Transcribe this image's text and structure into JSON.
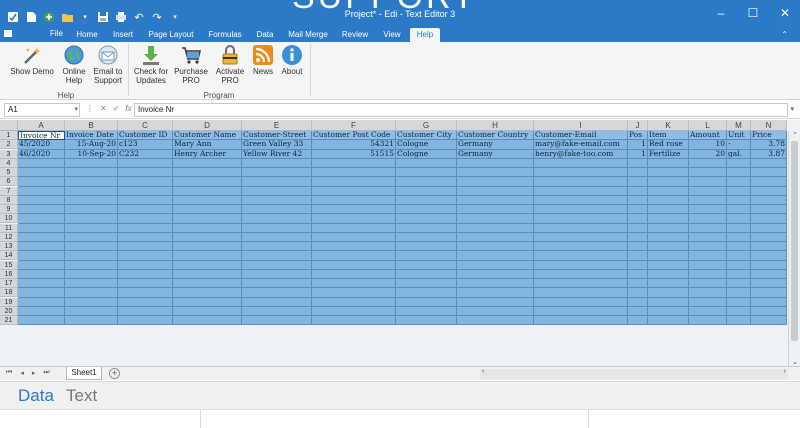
{
  "window": {
    "title": "Project* - Edi - Text Editor 3",
    "banner_text": "SUPPORT"
  },
  "menu": {
    "file": "File",
    "tabs": [
      "Home",
      "Insert",
      "Page Layout",
      "Formulas",
      "Data",
      "Mail Merge",
      "Review",
      "View",
      "Help"
    ],
    "active_tab": "Help"
  },
  "ribbon": {
    "groups": [
      {
        "label": "Help",
        "buttons": [
          {
            "label1": "Show Demo",
            "label2": "",
            "icon": "wand-icon"
          },
          {
            "label1": "Online",
            "label2": "Help",
            "icon": "globe-help-icon"
          },
          {
            "label1": "Email to",
            "label2": "Support",
            "icon": "email-support-icon"
          }
        ]
      },
      {
        "label": "Program",
        "buttons": [
          {
            "label1": "Check for",
            "label2": "Updates",
            "icon": "download-arrow-icon"
          },
          {
            "label1": "Purchase",
            "label2": "PRO",
            "icon": "shopping-cart-icon"
          },
          {
            "label1": "Activate",
            "label2": "PRO",
            "icon": "padlock-icon"
          },
          {
            "label1": "News",
            "label2": "",
            "icon": "rss-icon"
          },
          {
            "label1": "About",
            "label2": "",
            "icon": "info-icon"
          }
        ]
      }
    ]
  },
  "formula_bar": {
    "cell_ref": "A1",
    "value": "Invoice Nr"
  },
  "sheet": {
    "columns": [
      "A",
      "B",
      "C",
      "D",
      "E",
      "F",
      "G",
      "H",
      "I",
      "J",
      "K",
      "L",
      "M",
      "N"
    ],
    "row_numbers": [
      "1",
      "2",
      "3",
      "4",
      "5",
      "6",
      "7",
      "8",
      "9",
      "10",
      "11",
      "12",
      "13",
      "14",
      "15",
      "16",
      "17",
      "18",
      "19",
      "20",
      "21"
    ],
    "header_row": [
      "Invoice Nr",
      "Invoice Date",
      "Customer ID",
      "Customer Name",
      "Customer-Street",
      "Customer Post Code",
      "Customer City",
      "Customer Country",
      "Customer-Email",
      "Pos",
      "Item",
      "Amount",
      "Unit",
      "Price"
    ],
    "data_rows": [
      [
        "45/2020",
        "15-Aug-20",
        "c123",
        "Mary Ann",
        "Green Valley 33",
        "54321",
        "Cologne",
        "Germany",
        "mary@fake-email.com",
        "1",
        "Red rose",
        "10",
        "-",
        "3.78"
      ],
      [
        "46/2020",
        "10-Sep-20",
        "C232",
        "Henry Archer",
        "Yellow River 42",
        "51515",
        "Cologne",
        "Germany",
        "henry@fake-too.com",
        "1",
        "Fertilize",
        "20",
        "gal.",
        "3.87"
      ]
    ],
    "tab_name": "Sheet1"
  },
  "mode_tabs": {
    "data": "Data",
    "text": "Text",
    "active": "Data"
  },
  "colors": {
    "accent": "#2b79c7",
    "cell_fill": "#82b6e0",
    "grid_line": "#5a8dbd"
  }
}
